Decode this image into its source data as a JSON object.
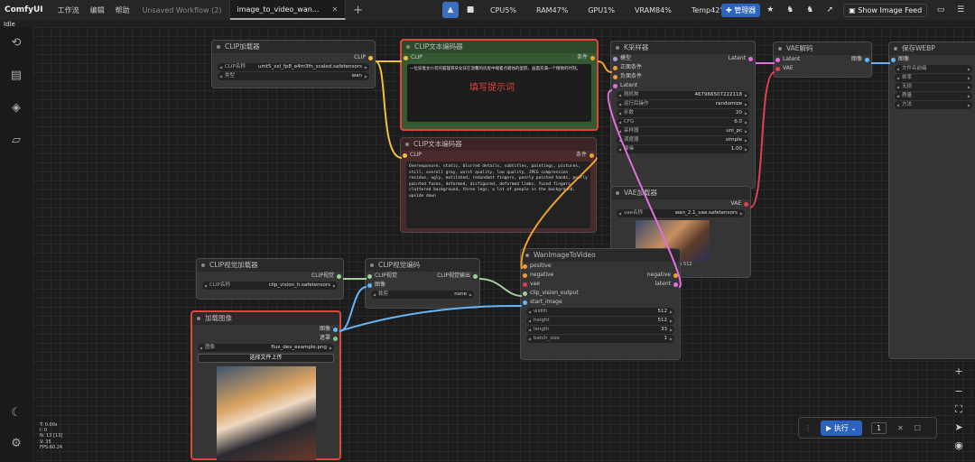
{
  "app": {
    "logo": "ComfyUI",
    "menus": [
      "工作流",
      "编辑",
      "帮助"
    ],
    "status": "Idle"
  },
  "tabs": [
    {
      "label": "Unsaved Workflow (2)"
    },
    {
      "label": "image_to_video_wan...",
      "close": "✕"
    }
  ],
  "plus_label": "+",
  "stats_bar": {
    "cpu": "CPU5%",
    "ram": "RAM47%",
    "gpu": "GPU1%",
    "vram": "VRAM84%",
    "temp": "Temp42°"
  },
  "toolbar": {
    "manager": "管理器",
    "feed": "Show Image Feed"
  },
  "nodes": {
    "clip_loader": {
      "title": "CLIP加载器",
      "out": "CLIP",
      "w1_label": "CLIP名称",
      "w1_value": "umt5_xxl_fp8_e4m3fn_scaled.safetensors",
      "w2_label": "类型",
      "w2_value": "wan"
    },
    "clip_text_pos": {
      "title": "CLIP文本编码器",
      "in": "CLIP",
      "out": "条件",
      "text": "一位穿着女仆装的狐狸耳朵女孩在温馨的房屋中端着点蜡烛的蛋糕，画面充满一个精致的时刻。",
      "annotation": "填写提示词"
    },
    "clip_text_neg": {
      "title": "CLIP文本编码器",
      "in": "CLIP",
      "out": "条件",
      "text": "Overexposure, static, blurred details, subtitles, paintings, pictures, still, overall gray, worst quality, low quality, JPEG compression residue, ugly, mutilated, redundant fingers, poorly painted hands, poorly painted faces, deformed, disfigured, deformed limbs, fused fingers, cluttered background, three legs, a lot of people in the background, upside down"
    },
    "ksampler": {
      "title": "K采样器",
      "inputs": [
        "模型",
        "正面条件",
        "负面条件",
        "Latent"
      ],
      "out": "Latent",
      "widgets": [
        {
          "l": "随机种",
          "v": "467966507222118"
        },
        {
          "l": "运行后操作",
          "v": "randomize"
        },
        {
          "l": "步数",
          "v": "20"
        },
        {
          "l": "CFG",
          "v": "6.0"
        },
        {
          "l": "采样器",
          "v": "uni_pc"
        },
        {
          "l": "调度器",
          "v": "simple"
        },
        {
          "l": "降噪",
          "v": "1.00"
        }
      ]
    },
    "vae_decode": {
      "title": "VAE解码",
      "in1": "Latent",
      "in2": "VAE",
      "out": "图像"
    },
    "save_webp": {
      "title": "保存WEBP",
      "in": "图像",
      "widgets": [
        "文件名前缀",
        "帧率",
        "无损",
        "质量",
        "方法"
      ]
    },
    "vae_loader": {
      "title": "VAE加载器",
      "out": "VAE",
      "w_label": "vae名称",
      "w_value": "wan_2.1_vae.safetensors",
      "size": "512 x 512"
    },
    "clip_vision_loader": {
      "title": "CLIP视觉加载器",
      "out": "CLIP视觉",
      "w_label": "CLIP名称",
      "w_value": "clip_vision_h.safetensors"
    },
    "clip_vision_encode": {
      "title": "CLIP视觉编码",
      "in1": "CLIP视觉",
      "in2": "图像",
      "out": "CLIP视觉输出",
      "w_label": "裁剪",
      "w_value": "none"
    },
    "wan_i2v": {
      "title": "WanImageToVideo",
      "inputs": [
        "positive",
        "negative",
        "vae",
        "clip_vision_output",
        "start_image"
      ],
      "outs": [
        "negative",
        "latent"
      ],
      "widgets": [
        {
          "l": "width",
          "v": "512"
        },
        {
          "l": "height",
          "v": "512"
        },
        {
          "l": "length",
          "v": "33"
        },
        {
          "l": "batch_size",
          "v": "1"
        }
      ]
    },
    "load_image": {
      "title": "加载图像",
      "out1": "图像",
      "out2": "遮罩",
      "w_label": "图像",
      "w_value": "flux_dev_example.png",
      "upload": "选择文件上传"
    }
  },
  "run": {
    "label": "执行",
    "count": "1"
  },
  "debug": [
    "T: 0.00s",
    "I: 0",
    "N: 13 [13]",
    "V: 35",
    "FPS:60.24"
  ],
  "colors": {
    "clip": "#f0c040",
    "cond": "#f0a030",
    "latent": "#e070e0",
    "vae": "#e04050",
    "image": "#64b5f6",
    "clipvision": "#a0d0a0",
    "highlight": "#e0443c"
  }
}
